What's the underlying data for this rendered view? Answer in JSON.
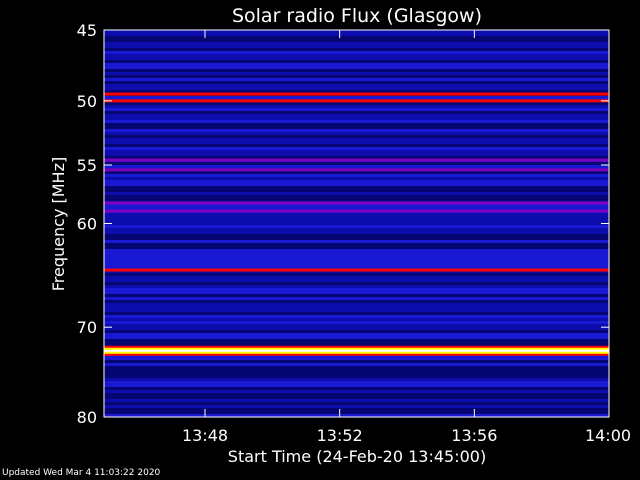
{
  "chart_data": {
    "type": "heatmap",
    "title": "Solar radio Flux (Glasgow)",
    "xlabel": "Start Time (24-Feb-20 13:45:00)",
    "ylabel": "Frequency [MHz]",
    "x_range": [
      "13:45:00",
      "14:00:00"
    ],
    "y_range_mhz": [
      45,
      80
    ],
    "y_scale": "log",
    "y_ticks": [
      "45",
      "50",
      "55",
      "60",
      "70",
      "80"
    ],
    "x_ticks": [
      "13:48",
      "13:52",
      "13:56",
      "14:00"
    ],
    "colormap": [
      "#000080",
      "#0000ff",
      "#8000c0",
      "#ff0000",
      "#ffff00",
      "#ffffff"
    ],
    "bands": [
      {
        "freq_mhz": 49.5,
        "level": "high"
      },
      {
        "freq_mhz": 50.0,
        "level": "high"
      },
      {
        "freq_mhz": 54.6,
        "level": "medium"
      },
      {
        "freq_mhz": 55.4,
        "level": "medium"
      },
      {
        "freq_mhz": 58.2,
        "level": "medium"
      },
      {
        "freq_mhz": 58.9,
        "level": "medium"
      },
      {
        "freq_mhz": 64.3,
        "level": "high"
      },
      {
        "freq_mhz": 72.5,
        "level": "saturated"
      }
    ]
  },
  "footer": "Updated Wed Mar  4 11:03:22 2020"
}
